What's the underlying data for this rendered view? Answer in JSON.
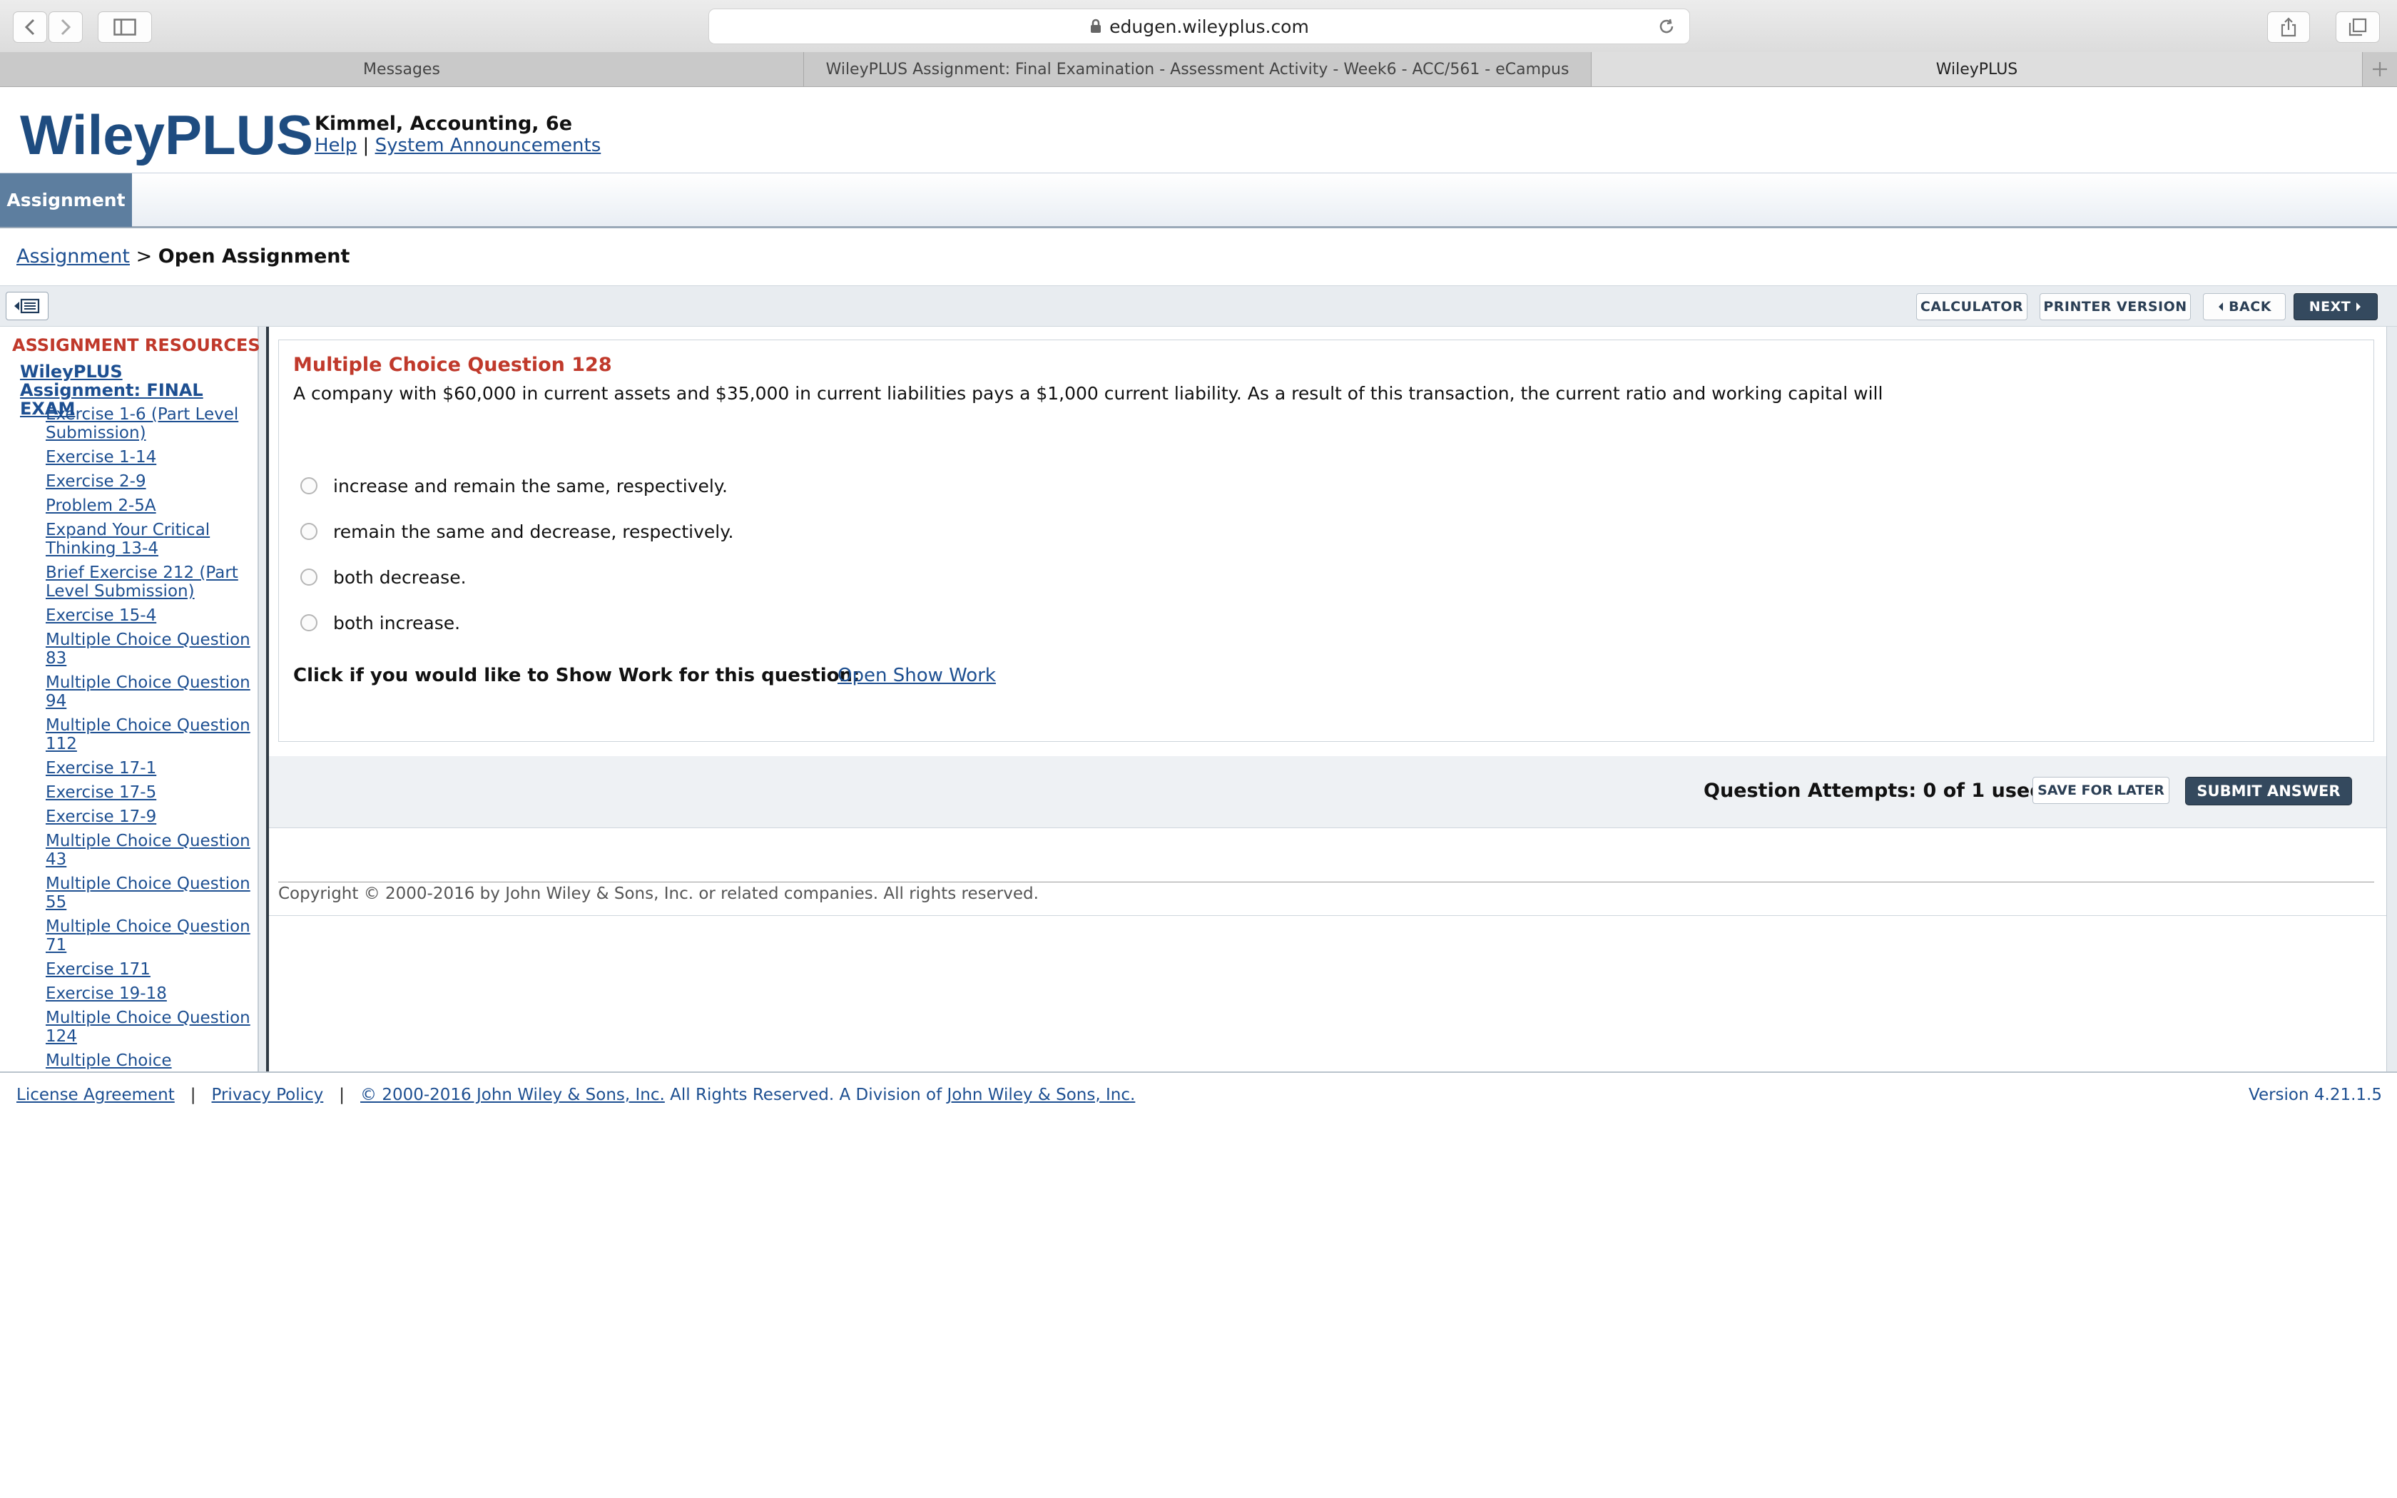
{
  "browser": {
    "url": "edugen.wileyplus.com",
    "tabs": [
      {
        "label": "Messages",
        "active": false
      },
      {
        "label": "WileyPLUS Assignment: Final Examination - Assessment Activity - Week6 - ACC/561 - eCampus",
        "active": false
      },
      {
        "label": "WileyPLUS",
        "active": true
      }
    ]
  },
  "header": {
    "logo": "WileyPLUS",
    "course_title": "Kimmel, Accounting, 6e",
    "help_link": "Help",
    "separator": "|",
    "announcements_link": "System Announcements"
  },
  "nav": {
    "assignment_tab": "Assignment"
  },
  "breadcrumb": {
    "parent": "Assignment",
    "separator": ">",
    "current": "Open Assignment"
  },
  "toolbar": {
    "calculator": "CALCULATOR",
    "printer_version": "PRINTER VERSION",
    "back": "BACK",
    "next": "NEXT"
  },
  "sidebar": {
    "heading": "ASSIGNMENT RESOURCES",
    "assignment_title": "WileyPLUS Assignment: FINAL EXAM",
    "items": [
      "Exercise 1-6 (Part Level Submission)",
      "Exercise 1-14",
      "Exercise 2-9",
      "Problem 2-5A",
      "Expand Your Critical Thinking 13-4",
      "Brief Exercise 212 (Part Level Submission)",
      "Exercise 15-4",
      "Multiple Choice Question 83",
      "Multiple Choice Question 94",
      "Multiple Choice Question 112",
      "Exercise 17-1",
      "Exercise 17-5",
      "Exercise 17-9",
      "Multiple Choice Question 43",
      "Multiple Choice Question 55",
      "Multiple Choice Question 71",
      "Exercise 171",
      "Exercise 19-18",
      "Multiple Choice Question 124",
      "Multiple Choice"
    ]
  },
  "question": {
    "title": "Multiple Choice Question 128",
    "text": "A company with $60,000 in current assets and $35,000 in current liabilities pays a $1,000 current liability. As a result of this transaction, the current ratio and working capital will",
    "options": [
      "increase and remain the same, respectively.",
      "remain the same and decrease, respectively.",
      "both decrease.",
      "both increase."
    ],
    "show_work_prompt": "Click if you would like to Show Work for this question:",
    "show_work_link": "Open Show Work",
    "attempts": "Question Attempts: 0 of 1 used",
    "save_for_later": "SAVE FOR LATER",
    "submit_answer": "SUBMIT ANSWER",
    "copyright": "Copyright © 2000-2016 by John Wiley & Sons, Inc. or related companies. All rights reserved."
  },
  "footer": {
    "license": "License Agreement",
    "privacy": "Privacy Policy",
    "copyright_link": "© 2000-2016 John Wiley & Sons, Inc.",
    "rights_text": " All Rights Reserved. A Division of ",
    "wiley_link": "John Wiley & Sons, Inc.",
    "separator": "|",
    "version": "Version 4.21.1.5"
  }
}
